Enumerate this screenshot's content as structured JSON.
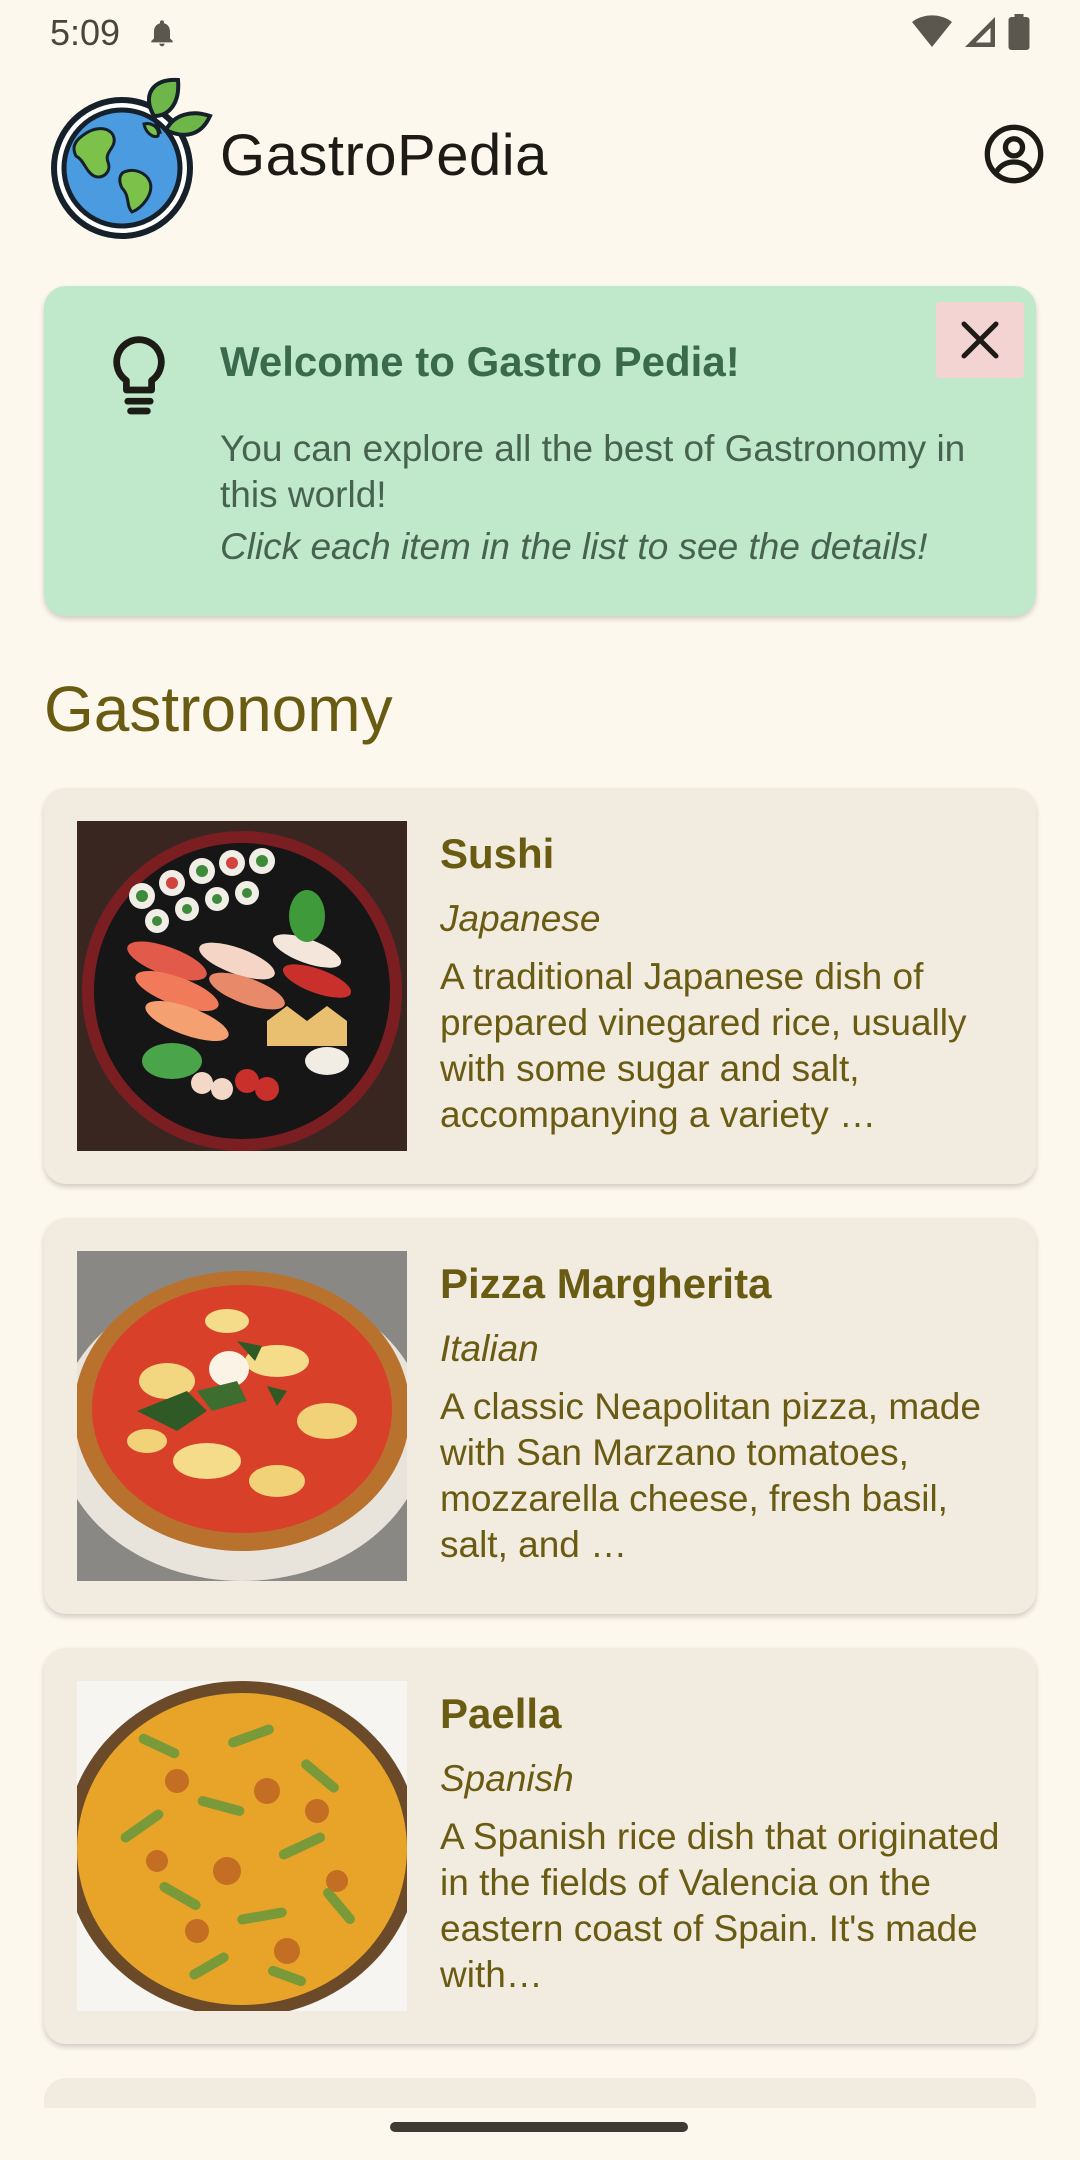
{
  "status_bar": {
    "time": "5:09"
  },
  "app_bar": {
    "title": "GastroPedia"
  },
  "welcome": {
    "title": "Welcome to Gastro Pedia!",
    "body": "You can explore all the best of Gastronomy in this world!",
    "hint": "Click each item in the list to see the details!"
  },
  "section": {
    "title": "Gastronomy"
  },
  "foods": [
    {
      "name": "Sushi",
      "origin": "Japanese",
      "description": "A traditional Japanese dish of prepared vinegared rice, usually with some sugar and salt, accompanying a variety …"
    },
    {
      "name": "Pizza Margherita",
      "origin": "Italian",
      "description": "A classic Neapolitan pizza, made with San Marzano tomatoes, mozzarella cheese, fresh basil, salt, and …"
    },
    {
      "name": "Paella",
      "origin": "Spanish",
      "description": "A Spanish rice dish that originated in the fields of Valencia on the eastern coast of Spain. It's made with…"
    }
  ],
  "colors": {
    "background": "#fdf8ee",
    "welcome_card": "#c0e8cb",
    "close_button": "#f4d4d3",
    "card": "#f2ebe0",
    "accent_text": "#6a5b12"
  },
  "icons": [
    "bell-icon",
    "wifi-icon",
    "signal-icon",
    "battery-icon",
    "account-icon",
    "lightbulb-icon",
    "close-icon"
  ]
}
